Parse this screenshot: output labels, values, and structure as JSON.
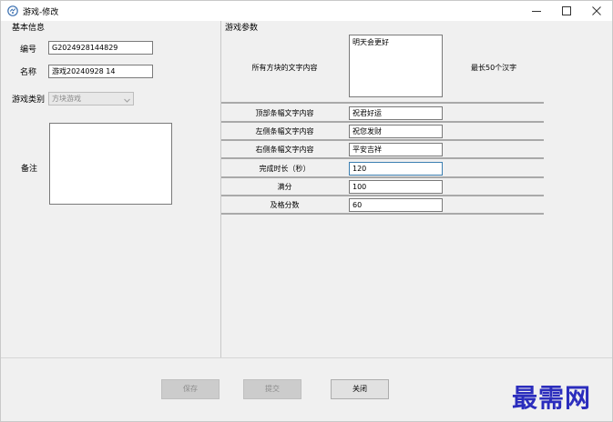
{
  "window": {
    "title": "游戏-修改",
    "controls": {
      "minimize": "–",
      "maximize": "☐",
      "close": "✕"
    }
  },
  "basic": {
    "section_title": "基本信息",
    "id_label": "编号",
    "id_value": "G2024928144829",
    "name_label": "名称",
    "name_value": "游戏20240928 14",
    "category_label": "游戏类别",
    "category_value": "方块游戏",
    "remark_label": "备注",
    "remark_value": ""
  },
  "params": {
    "section_title": "游戏参数",
    "block_text_label": "所有方块的文字内容",
    "block_text_value": "明天会更好",
    "block_text_hint": "最长50个汉字",
    "rows": [
      {
        "label": "顶部条幅文字内容",
        "value": "祝君好运"
      },
      {
        "label": "左侧条幅文字内容",
        "value": "祝您发财"
      },
      {
        "label": "右侧条幅文字内容",
        "value": "平安吉祥"
      },
      {
        "label": "完成时长（秒）",
        "value": "120"
      },
      {
        "label": "满分",
        "value": "100"
      },
      {
        "label": "及格分数",
        "value": "60"
      }
    ]
  },
  "buttons": {
    "save": "保存",
    "submit": "提交",
    "close": "关闭"
  },
  "watermark": "最需网",
  "colors": {
    "focus_border": "#3c7fb1",
    "watermark": "#2b2dbd",
    "window_bg": "#f0f0f0"
  }
}
